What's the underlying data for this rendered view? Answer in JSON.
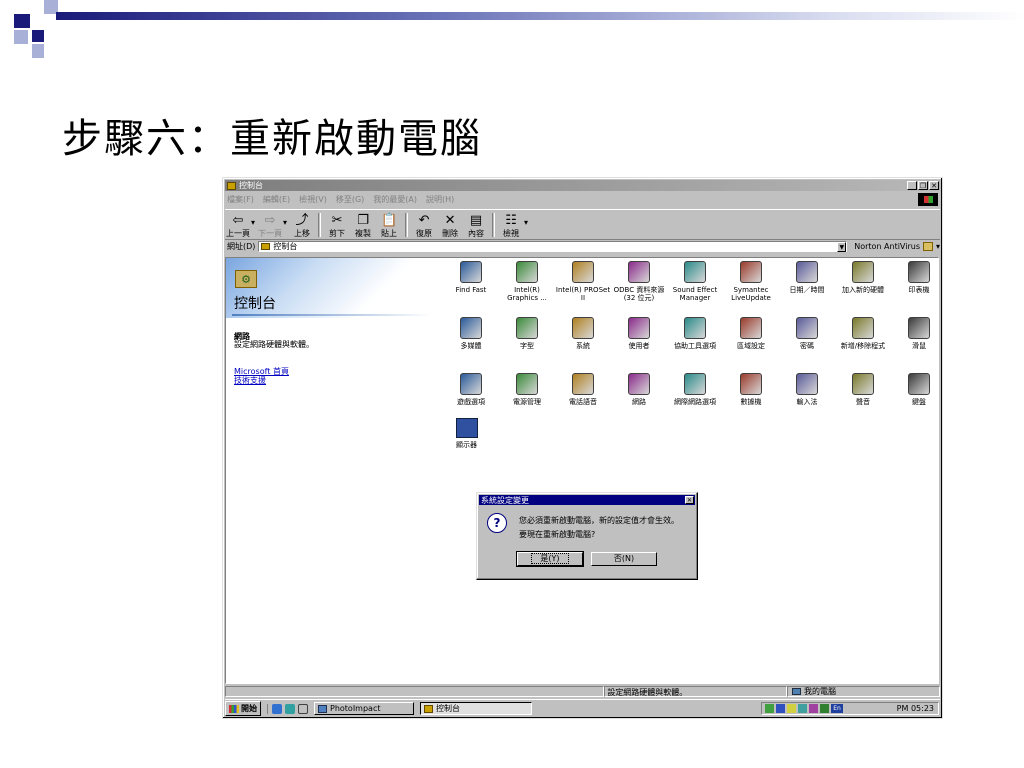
{
  "slide": {
    "title": "步驟六：重新啟動電腦"
  },
  "window": {
    "title": "控制台",
    "menu": [
      "檔案(F)",
      "編輯(E)",
      "檢視(V)",
      "移至(G)",
      "我的最愛(A)",
      "說明(H)"
    ],
    "toolbar": [
      {
        "label": "上一頁",
        "icon": "back-arrow-icon",
        "enabled": true
      },
      {
        "label": "下一頁",
        "icon": "forward-arrow-icon",
        "enabled": false
      },
      {
        "label": "上移",
        "icon": "up-folder-icon",
        "enabled": true
      },
      {
        "label": "剪下",
        "icon": "scissors-icon",
        "enabled": true
      },
      {
        "label": "複製",
        "icon": "copy-icon",
        "enabled": true
      },
      {
        "label": "貼上",
        "icon": "paste-icon",
        "enabled": true
      },
      {
        "label": "復原",
        "icon": "undo-icon",
        "enabled": true
      },
      {
        "label": "刪除",
        "icon": "delete-x-icon",
        "enabled": true
      },
      {
        "label": "內容",
        "icon": "properties-icon",
        "enabled": true
      },
      {
        "label": "檢視",
        "icon": "view-icon",
        "enabled": true
      }
    ],
    "address_label": "網址(D)",
    "address_value": "控制台",
    "norton_label": "Norton AntiVirus",
    "left_pane": {
      "title": "控制台",
      "heading": "網路",
      "description": "設定網路硬體與軟體。",
      "links": [
        "Microsoft 首頁",
        "技術支援"
      ]
    },
    "items": [
      {
        "label": "Find Fast",
        "icon": "binoculars-icon"
      },
      {
        "label": "Intel(R) Graphics ...",
        "icon": "display-adapter-icon"
      },
      {
        "label": "Intel(R) PROSet II",
        "icon": "network-card-icon"
      },
      {
        "label": "ODBC 資料來源 (32 位元)",
        "icon": "database-icon"
      },
      {
        "label": "Sound Effect Manager",
        "icon": "speaker-waves-icon"
      },
      {
        "label": "Symantec LiveUpdate",
        "icon": "globe-update-icon"
      },
      {
        "label": "日期／時間",
        "icon": "calendar-clock-icon"
      },
      {
        "label": "加入新的硬體",
        "icon": "add-hardware-icon"
      },
      {
        "label": "印表機",
        "icon": "printer-folder-icon"
      },
      {
        "label": "多媒體",
        "icon": "multimedia-icon"
      },
      {
        "label": "字型",
        "icon": "fonts-folder-icon"
      },
      {
        "label": "系統",
        "icon": "computer-icon"
      },
      {
        "label": "使用者",
        "icon": "users-icon"
      },
      {
        "label": "協助工具選項",
        "icon": "accessibility-icon"
      },
      {
        "label": "區域設定",
        "icon": "globe-icon"
      },
      {
        "label": "密碼",
        "icon": "keys-icon"
      },
      {
        "label": "新增/移除程式",
        "icon": "add-remove-programs-icon"
      },
      {
        "label": "滑鼠",
        "icon": "mouse-icon"
      },
      {
        "label": "遊戲選項",
        "icon": "joystick-icon"
      },
      {
        "label": "電源管理",
        "icon": "power-plug-icon"
      },
      {
        "label": "電話語音",
        "icon": "telephone-icon"
      },
      {
        "label": "網路",
        "icon": "network-icon"
      },
      {
        "label": "網際網路選項",
        "icon": "internet-globe-icon"
      },
      {
        "label": "數據機",
        "icon": "modem-icon"
      },
      {
        "label": "輸入法",
        "icon": "input-method-icon"
      },
      {
        "label": "聲音",
        "icon": "speaker-icon"
      },
      {
        "label": "鍵盤",
        "icon": "keyboard-icon"
      }
    ],
    "partial_item_label": "顯示器",
    "status_left": "",
    "status_mid": "設定網路硬體與軟體。",
    "status_right": "我的電腦"
  },
  "dialog": {
    "title": "系統設定變更",
    "message1": "您必須重新啟動電腦，新的設定值才會生效。",
    "message2": "要現在重新啟動電腦?",
    "yes_label": "是(Y)",
    "no_label": "否(N)"
  },
  "taskbar": {
    "start_label": "開始",
    "tasks": [
      "PhotoImpact",
      "控制台"
    ],
    "clock": "PM 05:23"
  },
  "colors": {
    "slide_accent": "#1a1a7a",
    "dialog_titlebar": "#000080",
    "window_chrome": "#c0c0c0"
  }
}
